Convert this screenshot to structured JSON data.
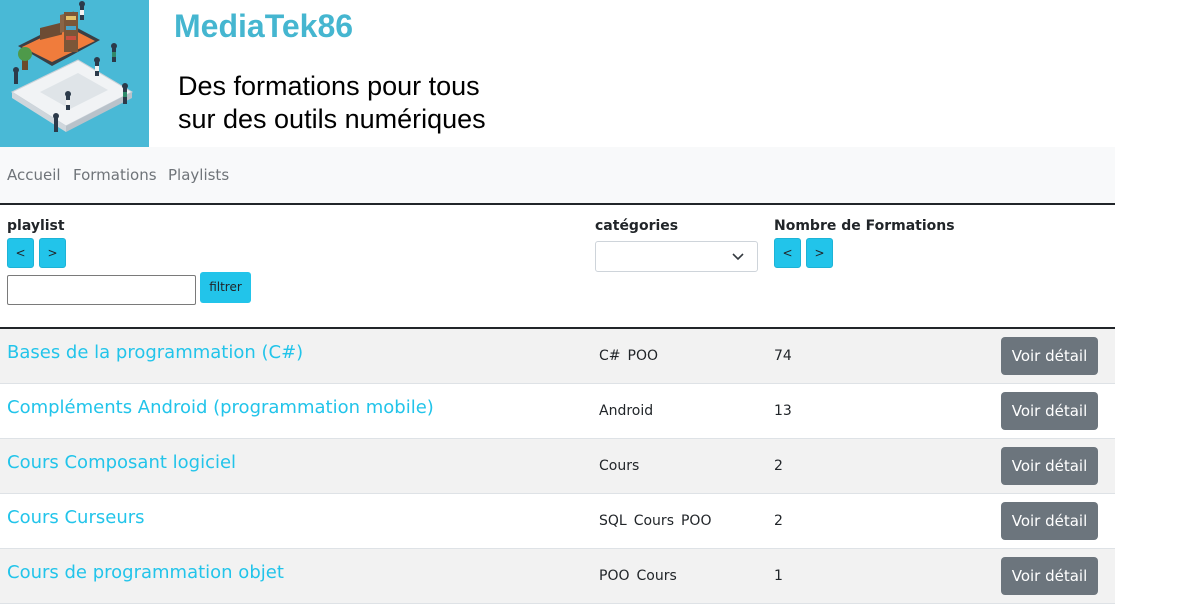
{
  "header": {
    "site_title": "MediaTek86",
    "tagline_line1": "Des formations pour tous",
    "tagline_line2": "sur des outils numériques",
    "logo_icon": "laptop-people-illustration"
  },
  "nav": {
    "items": [
      {
        "label": "Accueil"
      },
      {
        "label": "Formations"
      },
      {
        "label": "Playlists"
      }
    ]
  },
  "filters": {
    "playlist_label": "playlist",
    "categories_label": "catégories",
    "count_label": "Nombre de Formations",
    "sort_asc": "<",
    "sort_desc": ">",
    "filter_input_value": "",
    "filter_button": "filtrer",
    "category_selected": ""
  },
  "table": {
    "detail_button_label": "Voir détail",
    "rows": [
      {
        "title": "Bases de la programmation (C#)",
        "categories": [
          "C#",
          "POO"
        ],
        "count": "74"
      },
      {
        "title": "Compléments Android (programmation mobile)",
        "categories": [
          "Android"
        ],
        "count": "13"
      },
      {
        "title": "Cours Composant logiciel",
        "categories": [
          "Cours"
        ],
        "count": "2"
      },
      {
        "title": "Cours Curseurs",
        "categories": [
          "SQL",
          "Cours",
          "POO"
        ],
        "count": "2"
      },
      {
        "title": "Cours de programmation objet",
        "categories": [
          "POO",
          "Cours"
        ],
        "count": "1"
      }
    ]
  },
  "colors": {
    "accent": "#22c4ea",
    "title": "#45b6d0",
    "logo_bg": "#49b9d6",
    "detail_button": "#6c757d"
  }
}
